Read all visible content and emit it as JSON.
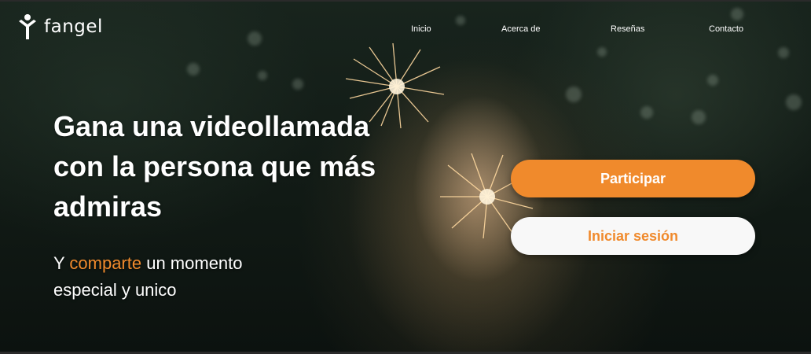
{
  "brand": {
    "name": "fangel",
    "logo_icon": "person-figure-icon"
  },
  "nav": {
    "items": [
      "Inicio",
      "Acerca de",
      "Reseñas",
      "Contacto"
    ]
  },
  "hero": {
    "title_line1": "Gana una videollamada",
    "title_line2": "con la persona que más",
    "title_line3": "admiras",
    "sub_prefix": "Y ",
    "sub_accent": "comparte",
    "sub_line1_suffix": " un momento",
    "sub_line2": "especial y unico"
  },
  "actions": {
    "primary_label": "Participar",
    "secondary_label": "Iniciar sesión"
  },
  "colors": {
    "accent": "#f08a2c",
    "text_light": "#ffffff",
    "button_light": "#f8f8f8"
  }
}
